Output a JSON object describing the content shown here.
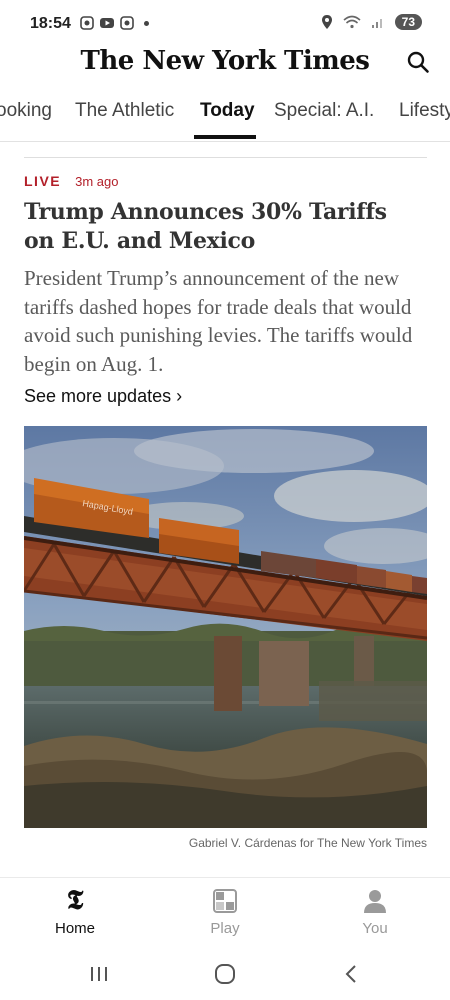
{
  "status_bar": {
    "time": "18:54",
    "battery": "73"
  },
  "header": {
    "logo": "The New York Times"
  },
  "tabs": [
    {
      "label": "ooking"
    },
    {
      "label": "The Athletic"
    },
    {
      "label": "Today",
      "active": true
    },
    {
      "label": "Special: A.I."
    },
    {
      "label": "Lifesty"
    }
  ],
  "article": {
    "live_label": "LIVE",
    "time_ago": "3m ago",
    "headline": "Trump Announces 30% Tariffs on E.U. and Mexico",
    "summary": "President Trump’s announcement of the new tariffs dashed hopes for trade deals that would avoid such punishing levies. The tariffs would begin on Aug. 1.",
    "more_link": "See more updates ›",
    "photo_credit": "Gabriel V. Cárdenas for The New York Times",
    "photo_container_text": "Hapag-Lloyd"
  },
  "bottom_nav": {
    "home": "Home",
    "play": "Play",
    "you": "You"
  },
  "colors": {
    "live_red": "#b3202a",
    "text_dark": "#121212",
    "text_gray": "#5a5a5a"
  }
}
